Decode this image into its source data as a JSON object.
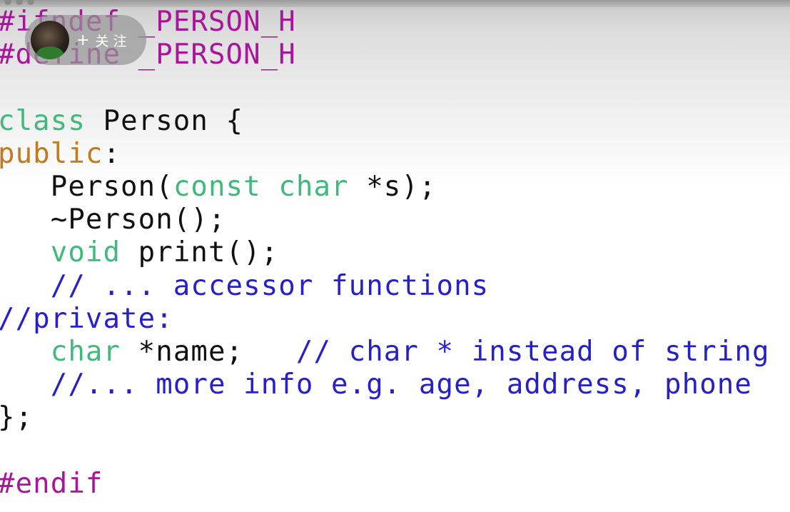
{
  "titlebar": {
    "text": ""
  },
  "overlay": {
    "plus": "+",
    "follow_label": "关注"
  },
  "code": {
    "l1": {
      "a": "#ifndef",
      "b": " _PERSON_H"
    },
    "l2": {
      "a": "#define",
      "b": " _PERSON_H"
    },
    "l4": {
      "a": "class",
      "b": " Person {"
    },
    "l5": {
      "a": "public",
      "b": ":"
    },
    "l6": {
      "a": "   Person(",
      "b": "const",
      "c": " ",
      "d": "char",
      "e": " *s);"
    },
    "l7": {
      "a": "   ~Person();"
    },
    "l8": {
      "a": "   ",
      "b": "void",
      "c": " print();"
    },
    "l9": {
      "a": "   ",
      "b": "// ... accessor functions"
    },
    "l10": {
      "a": "//private:"
    },
    "l11": {
      "a": "   ",
      "b": "char",
      "c": " *name;   ",
      "d": "// char * instead of string"
    },
    "l12": {
      "a": "   ",
      "b": "//... more info e.g. age, address, phone"
    },
    "l13": {
      "a": "};"
    },
    "l15": {
      "a": "#endif"
    }
  },
  "colors": {
    "preprocessor": "#a8159a",
    "keyword": "#3fb97c",
    "access": "#c07a20",
    "comment": "#2620c8",
    "plain": "#111111"
  }
}
